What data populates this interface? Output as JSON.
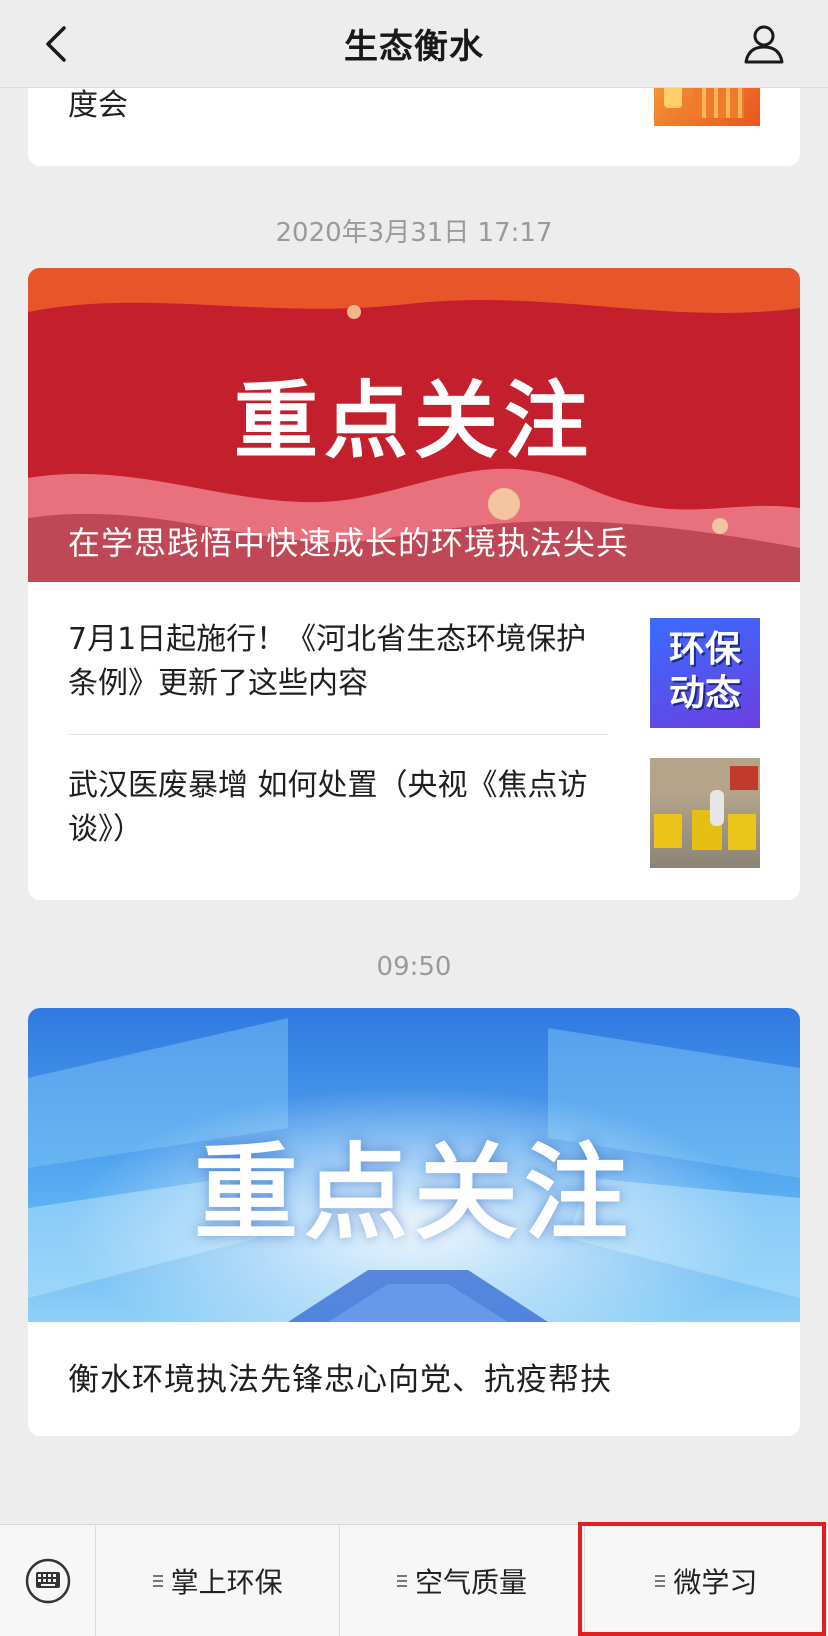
{
  "header": {
    "title": "生态衡水"
  },
  "previous_item": {
    "title_fragment": "度会"
  },
  "groups": [
    {
      "time": "2020年3月31日 17:17",
      "cover": {
        "banner_text": "重点关注",
        "caption": "在学思践悟中快速成长的环境执法尖兵"
      },
      "items": [
        {
          "title": "7月1日起施行！《河北省生态环境保护条例》更新了这些内容",
          "thumb_text": [
            "环保",
            "动态"
          ]
        },
        {
          "title": "武汉医废暴增 如何处置（央视《焦点访谈》）"
        }
      ]
    },
    {
      "time": "09:50",
      "cover": {
        "banner_text": "重点关注"
      },
      "title": "衡水环境执法先锋忠心向党、抗疫帮扶"
    }
  ],
  "menu": {
    "items": [
      {
        "label": "掌上环保"
      },
      {
        "label": "空气质量"
      },
      {
        "label": "微学习"
      }
    ]
  },
  "colors": {
    "highlight": "#e02020",
    "banner_red": "#c8202a",
    "banner_blue": "#3f8fe6"
  }
}
